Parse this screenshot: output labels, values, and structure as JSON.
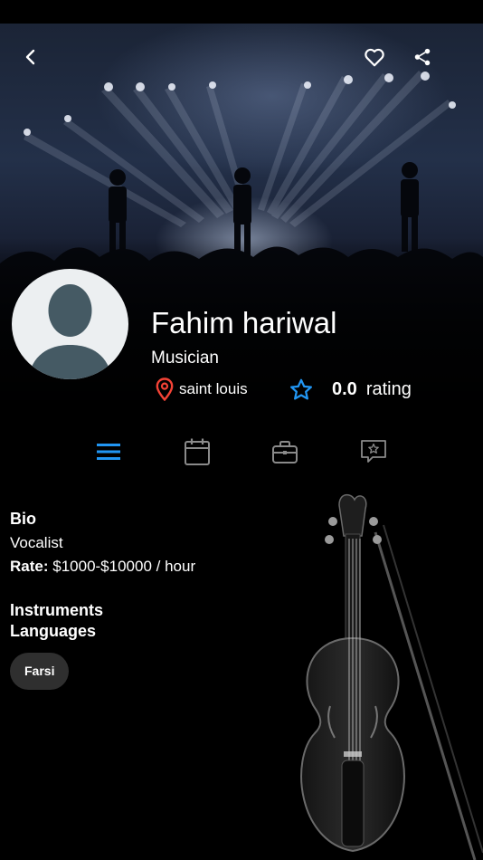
{
  "header": {
    "back_icon": "chevron-left-icon",
    "favorite_icon": "heart-outline-icon",
    "share_icon": "share-icon"
  },
  "profile": {
    "name": "Fahim hariwal",
    "role": "Musician",
    "location": "saint louis",
    "rating_value": "0.0",
    "rating_label": "rating"
  },
  "colors": {
    "accent": "#2196F3",
    "location_pin": "#F44336",
    "background": "#000000",
    "chip_bg": "#2F2F2F",
    "avatar_bg": "#ECEFF1",
    "avatar_silhouette": "#455A64"
  },
  "tabs": [
    {
      "icon": "menu-lines-icon",
      "active": true
    },
    {
      "icon": "calendar-icon",
      "active": false
    },
    {
      "icon": "briefcase-icon",
      "active": false
    },
    {
      "icon": "review-star-bubble-icon",
      "active": false
    }
  ],
  "about": {
    "bio_title": "Bio",
    "bio_text": "Vocalist",
    "rate_label": "Rate:",
    "rate_value": "$1000-$10000 / hour",
    "instruments_title": "Instruments",
    "languages_title": "Languages",
    "languages": [
      "Farsi"
    ]
  }
}
